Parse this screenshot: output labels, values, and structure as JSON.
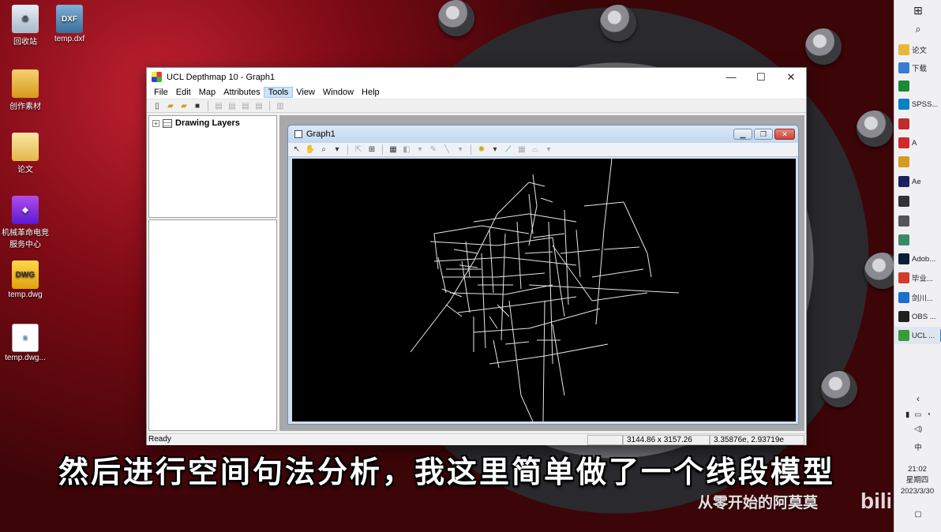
{
  "desktop": {
    "icons": [
      {
        "label": "回收站"
      },
      {
        "label": "temp.dxf",
        "badge": "DXF"
      },
      {
        "label": "创作素材"
      },
      {
        "label": "论文"
      },
      {
        "label": "机械革命电竞服务中心"
      },
      {
        "label": "temp.dwg",
        "badge": "DWG"
      },
      {
        "label": "temp.dwg..."
      }
    ]
  },
  "taskbar": {
    "items": [
      {
        "label": "论文",
        "icon": "folder-icon",
        "color": "#e8b73a"
      },
      {
        "label": "下载",
        "icon": "download-icon",
        "color": "#3a7bd5"
      },
      {
        "label": "",
        "icon": "app-icon",
        "color": "#1a8a3a"
      },
      {
        "label": "SPSS...",
        "icon": "browser-icon",
        "color": "#0a7fc9"
      },
      {
        "label": "",
        "icon": "app-icon",
        "color": "#c42b2b"
      },
      {
        "label": "A",
        "icon": "autocad-icon",
        "color": "#d12a2a"
      },
      {
        "label": "",
        "icon": "app-icon",
        "color": "#d69a20"
      },
      {
        "label": "Ae",
        "icon": "after-effects-icon",
        "color": "#1e2060"
      },
      {
        "label": "",
        "icon": "app-icon",
        "color": "#333333"
      },
      {
        "label": "",
        "icon": "app-icon",
        "color": "#555555"
      },
      {
        "label": "",
        "icon": "app-icon",
        "color": "#3a8a6a"
      },
      {
        "label": "Adob...",
        "icon": "photoshop-icon",
        "color": "#0b1d3a"
      },
      {
        "label": "毕业...",
        "icon": "wps-icon",
        "color": "#d63a2a"
      },
      {
        "label": "剑川...",
        "icon": "browser-icon",
        "color": "#1a6fcf"
      },
      {
        "label": "OBS ...",
        "icon": "obs-icon",
        "color": "#202020"
      },
      {
        "label": "UCL ...",
        "icon": "depthmap-icon",
        "color": "#3a9a3a"
      }
    ],
    "time": "21:02",
    "weekday": "星期四",
    "date": "2023/3/30",
    "ime": "中"
  },
  "app": {
    "title": "UCL Depthmap 10 - Graph1",
    "menu": [
      "File",
      "Edit",
      "Map",
      "Attributes",
      "Tools",
      "View",
      "Window",
      "Help"
    ],
    "tree_root": "Drawing Layers",
    "child_title": "Graph1",
    "status": {
      "ready": "Ready",
      "size": "3144.86 x 3157.26",
      "coords": "3.35876e, 2.93719e"
    }
  },
  "overlay": {
    "subtitle": "然后进行空间句法分析，我这里简单做了一个线段模型",
    "watermark": "从零开始的阿莫莫"
  },
  "colors": {
    "axial_lines": "#e6e6e6",
    "canvas_bg": "#000000"
  }
}
